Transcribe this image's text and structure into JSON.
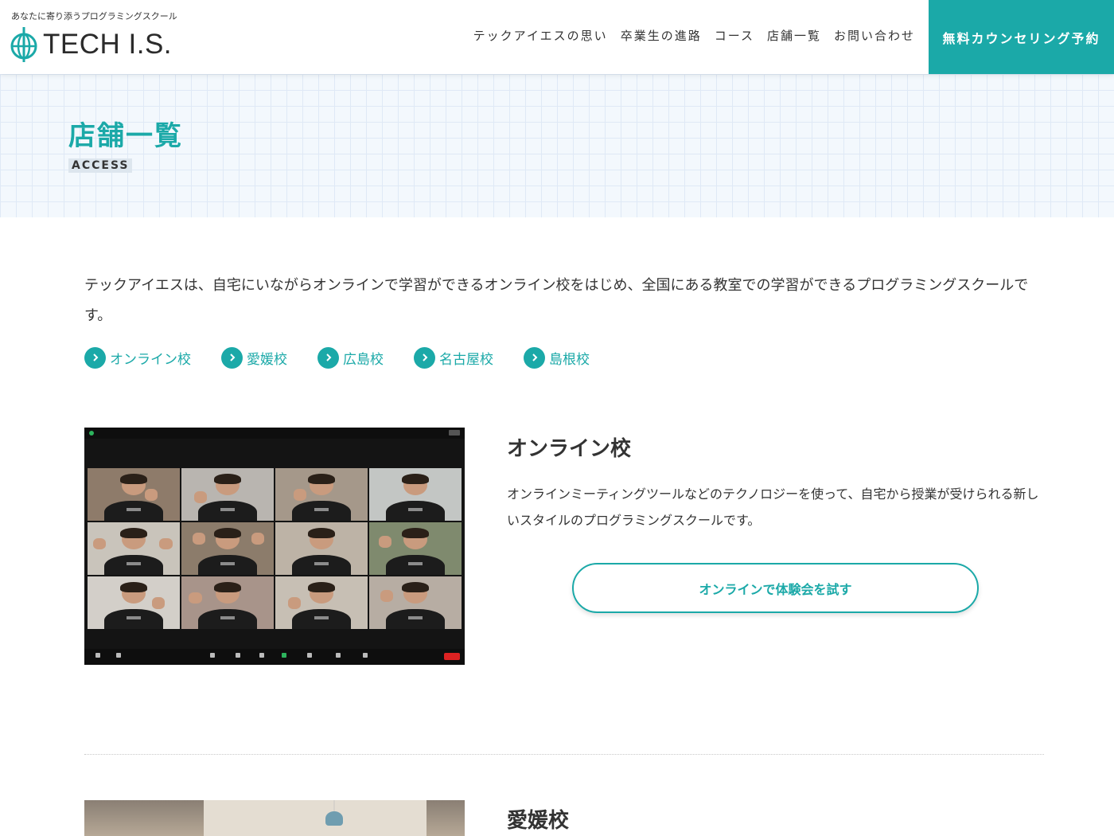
{
  "header": {
    "tagline": "あなたに寄り添うプログラミングスクール",
    "logo_text": "TECH I.S.",
    "nav": [
      {
        "label": "テックアイエスの思い"
      },
      {
        "label": "卒業生の進路"
      },
      {
        "label": "コース"
      },
      {
        "label": "店舗一覧"
      },
      {
        "label": "お問い合わせ"
      }
    ],
    "cta_label": "無料カウンセリング予約"
  },
  "hero": {
    "title": "店舗一覧",
    "subtitle": "ACCESS"
  },
  "intro": {
    "text": "テックアイエスは、自宅にいながらオンラインで学習ができるオンライン校をはじめ、全国にある教室での学習ができるプログラミングスクールです。",
    "anchors": [
      {
        "label": "オンライン校"
      },
      {
        "label": "愛媛校"
      },
      {
        "label": "広島校"
      },
      {
        "label": "名古屋校"
      },
      {
        "label": "島根校"
      }
    ]
  },
  "sections": [
    {
      "title": "オンライン校",
      "description": "オンラインミーティングツールなどのテクノロジーを使って、自宅から授業が受けられる新しいスタイルのプログラミングスクールです。",
      "button_label": "オンラインで体験会を試す"
    },
    {
      "title": "愛媛校"
    }
  ],
  "colors": {
    "accent": "#1ba9a8",
    "text": "#333333",
    "hero_bg": "#f3f8fd"
  }
}
